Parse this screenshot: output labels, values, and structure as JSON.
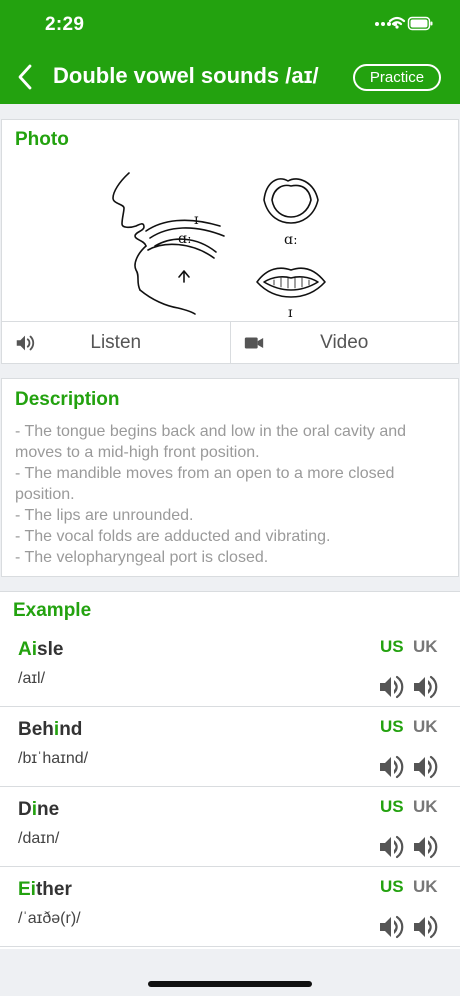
{
  "status": {
    "time": "2:29"
  },
  "header": {
    "title": "Double vowel sounds /aɪ/",
    "practice_label": "Practice"
  },
  "photo": {
    "title": "Photo",
    "diagram_labels": {
      "profile_top": "ɪ",
      "profile_bottom": "ɑː",
      "lips_open": "ɑː",
      "lips_closed": "ɪ"
    },
    "listen_label": "Listen",
    "video_label": "Video"
  },
  "description": {
    "title": "Description",
    "lines": [
      "- The tongue begins back and low in the oral cavity and moves to a mid-high front position.",
      "- The mandible moves from an open to a more closed position.",
      "- The lips are unrounded.",
      "- The vocal folds are adducted and vibrating.",
      "- The velopharyngeal port is closed."
    ]
  },
  "example": {
    "title": "Example",
    "us_label": "US",
    "uk_label": "UK",
    "items": [
      {
        "pre": "",
        "hl": "Ai",
        "post": "sle",
        "ipa": "/aɪl/"
      },
      {
        "pre": "Beh",
        "hl": "i",
        "post": "nd",
        "ipa": "/bɪˈhaɪnd/"
      },
      {
        "pre": "D",
        "hl": "i",
        "post": "ne",
        "ipa": "/daɪn/"
      },
      {
        "pre": "",
        "hl": "Ei",
        "post": "ther",
        "ipa": "/ˈaɪðə(r)/"
      }
    ]
  },
  "colors": {
    "accent": "#23a20f",
    "header_bg": "#23a20f",
    "page_bg": "#eef0f3"
  }
}
